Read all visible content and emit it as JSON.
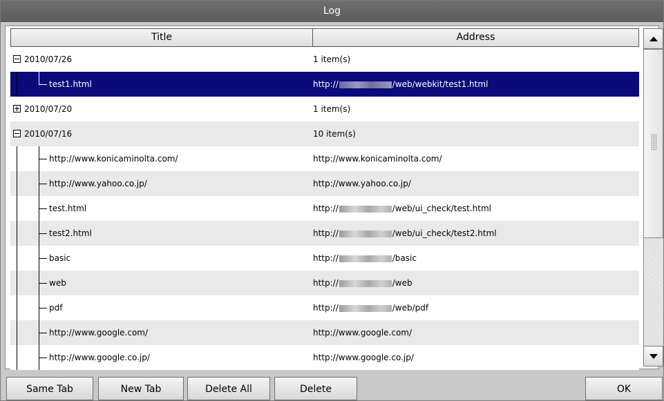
{
  "window": {
    "title": "Log"
  },
  "columns": {
    "title": "Title",
    "address": "Address"
  },
  "rows": [
    {
      "kind": "group",
      "expanded": true,
      "title": "2010/07/26",
      "address": "1 item(s)"
    },
    {
      "kind": "child",
      "selected": true,
      "last": true,
      "title": "test1.html",
      "addr_prefix": "http://",
      "redacted": true,
      "addr_suffix": "/web/webkit/test1.html"
    },
    {
      "kind": "group",
      "expanded": false,
      "title": "2010/07/20",
      "address": "1 item(s)"
    },
    {
      "kind": "group",
      "expanded": true,
      "title": "2010/07/16",
      "address": "10 item(s)"
    },
    {
      "kind": "child",
      "title": "http://www.konicaminolta.com/",
      "addr_prefix": "http://www.konicaminolta.com/",
      "redacted": false,
      "addr_suffix": ""
    },
    {
      "kind": "child",
      "title": "http://www.yahoo.co.jp/",
      "addr_prefix": "http://www.yahoo.co.jp/",
      "redacted": false,
      "addr_suffix": ""
    },
    {
      "kind": "child",
      "title": "test.html",
      "addr_prefix": "http://",
      "redacted": true,
      "addr_suffix": "/web/ui_check/test.html"
    },
    {
      "kind": "child",
      "title": "test2.html",
      "addr_prefix": "http://",
      "redacted": true,
      "addr_suffix": "/web/ui_check/test2.html"
    },
    {
      "kind": "child",
      "title": "basic",
      "addr_prefix": "http://",
      "redacted": true,
      "addr_suffix": "/basic"
    },
    {
      "kind": "child",
      "title": "web",
      "addr_prefix": "http://",
      "redacted": true,
      "addr_suffix": "/web"
    },
    {
      "kind": "child",
      "title": "pdf",
      "addr_prefix": "http://",
      "redacted": true,
      "addr_suffix": "/web/pdf"
    },
    {
      "kind": "child",
      "title": "http://www.google.com/",
      "addr_prefix": "http://www.google.com/",
      "redacted": false,
      "addr_suffix": ""
    },
    {
      "kind": "child",
      "title": "http://www.google.co.jp/",
      "addr_prefix": "http://www.google.co.jp/",
      "redacted": false,
      "addr_suffix": ""
    }
  ],
  "buttons": {
    "same_tab": "Same Tab",
    "new_tab": "New Tab",
    "delete_all": "Delete All",
    "delete": "Delete",
    "ok": "OK"
  },
  "icons": {
    "scroll_up": "triangle-up-icon",
    "scroll_down": "triangle-down-icon",
    "collapse": "minus-box-icon",
    "expand": "plus-box-icon"
  },
  "colors": {
    "selection": "#0a0a7a",
    "titlebar": "#666666",
    "row_alt": "#e9e9e9"
  }
}
